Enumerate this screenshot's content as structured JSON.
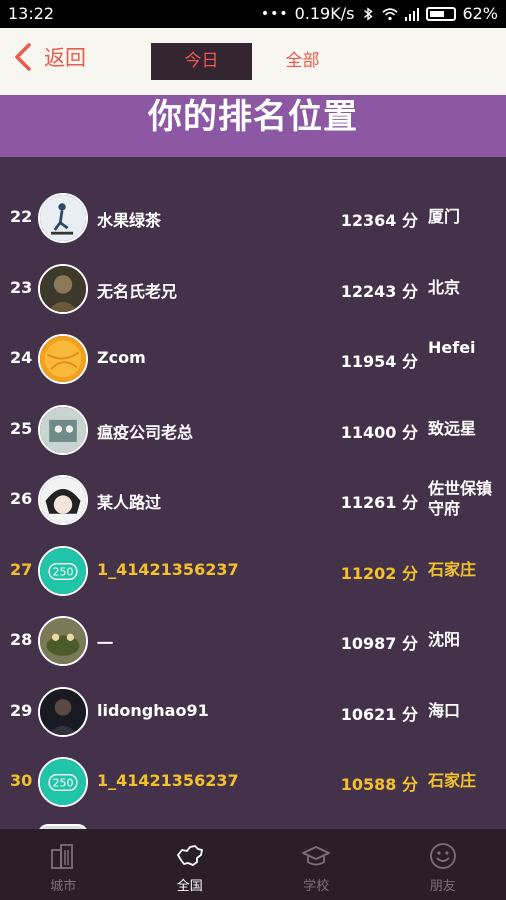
{
  "status_bar": {
    "time": "13:22",
    "network_speed": "0.19K/s",
    "battery": "62%",
    "battery_level": 0.62
  },
  "header": {
    "back_label": "返回",
    "tabs": [
      {
        "label": "今日",
        "active": true
      },
      {
        "label": "全部",
        "active": false
      }
    ]
  },
  "banner": {
    "title": "你的排名位置"
  },
  "rankings": [
    {
      "rank": "22",
      "name": "水果绿茶",
      "score": "12364 分",
      "city": "厦门",
      "avatar": "skater-avatar",
      "highlight": false
    },
    {
      "rank": "23",
      "name": "无名氏老兄",
      "score": "12243 分",
      "city": "北京",
      "avatar": "portrait-avatar",
      "highlight": false
    },
    {
      "rank": "24",
      "name": "Zcom",
      "score": "11954 分",
      "city": "Hefei",
      "avatar": "orange-ball-avatar",
      "highlight": false
    },
    {
      "rank": "25",
      "name": "瘟疫公司老总",
      "score": "11400 分",
      "city": "致远星",
      "avatar": "cartoon-avatar",
      "highlight": false
    },
    {
      "rank": "26",
      "name": "某人路过",
      "score": "11261 分",
      "city": "佐世保镇守府",
      "avatar": "anime-avatar",
      "highlight": false
    },
    {
      "rank": "27",
      "name": "1_41421356237",
      "score": "11202 分",
      "city": "石家庄",
      "avatar": "teal-250-avatar",
      "badge": "250",
      "highlight": true
    },
    {
      "rank": "28",
      "name": "一",
      "score": "10987 分",
      "city": "沈阳",
      "avatar": "frog-avatar",
      "highlight": false
    },
    {
      "rank": "29",
      "name": "lidonghao91",
      "score": "10621 分",
      "city": "海口",
      "avatar": "dark-portrait-avatar",
      "highlight": false
    },
    {
      "rank": "30",
      "name": "1_41421356237",
      "score": "10588 分",
      "city": "石家庄",
      "avatar": "teal-250-avatar",
      "badge": "250",
      "highlight": true
    }
  ],
  "bottom_nav": [
    {
      "label": "城市",
      "icon": "city-icon",
      "active": false
    },
    {
      "label": "全国",
      "icon": "china-map-icon",
      "active": true
    },
    {
      "label": "学校",
      "icon": "graduation-cap-icon",
      "active": false
    },
    {
      "label": "朋友",
      "icon": "smiley-icon",
      "active": false
    }
  ],
  "colors": {
    "accent": "#ea5a4a",
    "highlight": "#f3c22a",
    "banner": "#8c58a4",
    "list_bg": "#43324a",
    "nav_bg": "#2a1f29"
  }
}
